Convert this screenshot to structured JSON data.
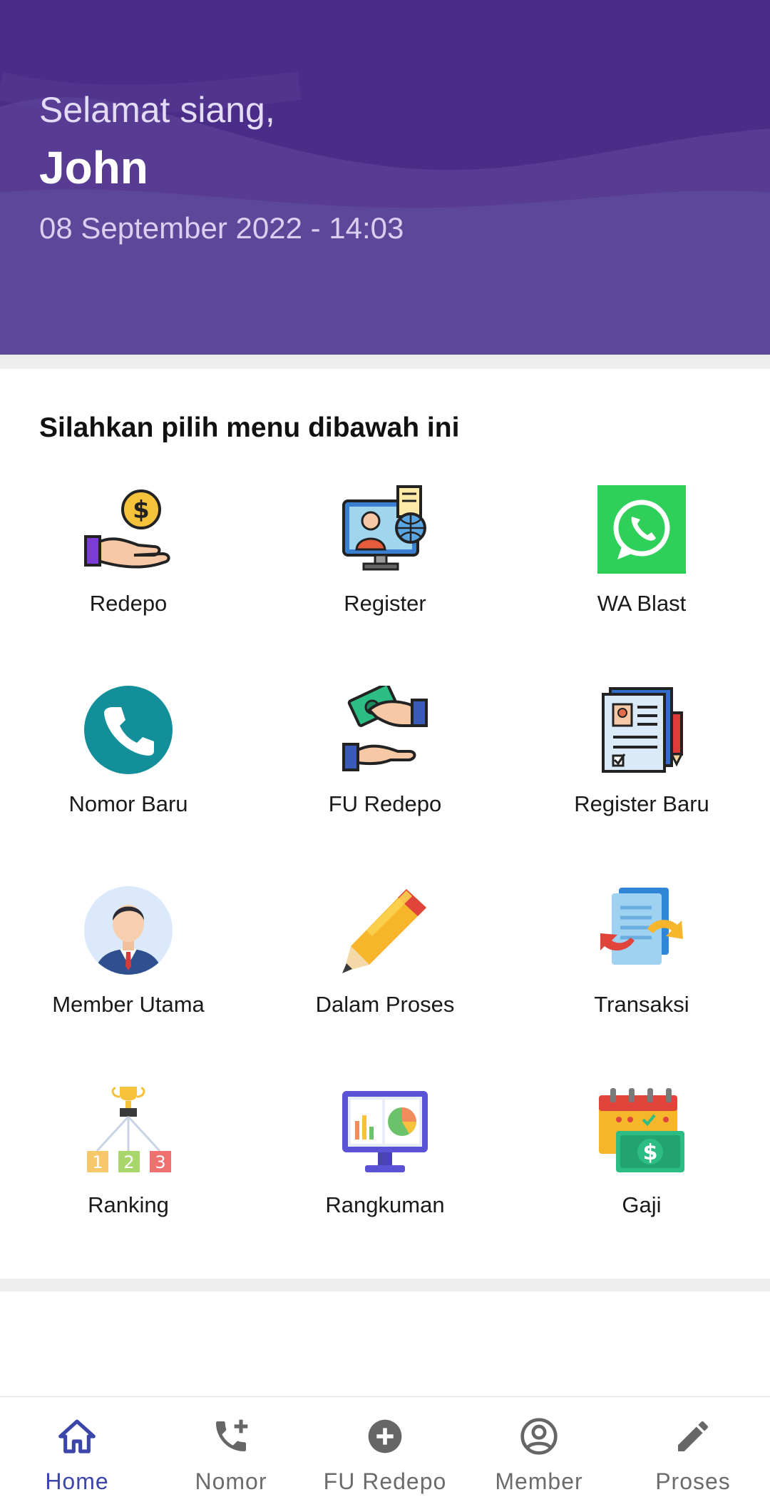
{
  "header": {
    "greeting": "Selamat siang,",
    "name": "John",
    "datetime": "08 September 2022 - 14:03",
    "bg_color": "#4c2f8c"
  },
  "menu": {
    "title": "Silahkan pilih menu dibawah ini",
    "items": [
      {
        "label": "Redepo",
        "icon": "money-hand-icon"
      },
      {
        "label": "Register",
        "icon": "monitor-globe-icon"
      },
      {
        "label": "WA Blast",
        "icon": "whatsapp-icon"
      },
      {
        "label": "Nomor Baru",
        "icon": "phone-icon"
      },
      {
        "label": "FU Redepo",
        "icon": "cash-exchange-icon"
      },
      {
        "label": "Register Baru",
        "icon": "registration-form-icon"
      },
      {
        "label": "Member Utama",
        "icon": "businessman-avatar-icon"
      },
      {
        "label": "Dalam Proses",
        "icon": "pencil-icon"
      },
      {
        "label": "Transaksi",
        "icon": "document-transfer-icon"
      },
      {
        "label": "Ranking",
        "icon": "trophy-podium-icon"
      },
      {
        "label": "Rangkuman",
        "icon": "analytics-monitor-icon"
      },
      {
        "label": "Gaji",
        "icon": "calendar-salary-icon"
      }
    ]
  },
  "bottom_nav": {
    "active_color": "#3c45a8",
    "items": [
      {
        "label": "Home",
        "icon": "home-icon",
        "active": true
      },
      {
        "label": "Nomor",
        "icon": "phone-add-icon",
        "active": false
      },
      {
        "label": "FU Redepo",
        "icon": "plus-circle-icon",
        "active": false
      },
      {
        "label": "Member",
        "icon": "account-circle-icon",
        "active": false
      },
      {
        "label": "Proses",
        "icon": "pencil-icon",
        "active": false
      }
    ]
  }
}
